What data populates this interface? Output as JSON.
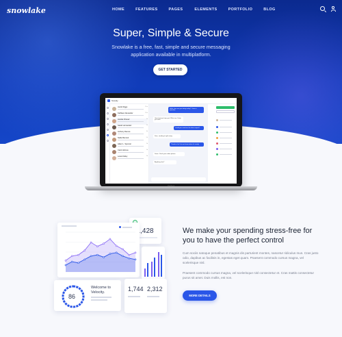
{
  "brand": {
    "logo": "snowlake"
  },
  "nav": {
    "items": [
      "HOME",
      "FEATURES",
      "PAGES",
      "ELEMENTS",
      "PORTFOLIO",
      "BLOG"
    ]
  },
  "icons": {
    "search": "search-icon",
    "user": "user-icon"
  },
  "hero": {
    "title": "Super, Simple & Secure",
    "subtitle": "Snowlake is a free, fast, simple and secure messaging application available in multiplatform.",
    "cta": "GET STARTED"
  },
  "laptop": {
    "brand": "MacBook",
    "app_name": "Snowly"
  },
  "feature": {
    "heading": "We make your spending stress-free for you to have the perfect control",
    "para1": "Cum sociis natoque penatibus et magnis dis parturient montes, nascetur ridiculus mus. Cras justo odio, dapibus ac facilisis in, egestas eget quam. Praesent commodo cursus magna, vel scelerisque nisl.",
    "para2": "Praesent commodo cursus magna, vel scelerisque nisl consectetur et. Cras mattis consectetur purus sit amet. Duis mollis, est non.",
    "button": "MORE DETAILS"
  },
  "dashboard": {
    "amount": "$1,428",
    "gauge_value": "86",
    "welcome_title": "Welcome to Velocity.",
    "stat_left": "1,744",
    "stat_right": "2,312"
  },
  "colors": {
    "primary": "#2a56e8",
    "hero_dark": "#0b2a8f",
    "accent_purple": "#7a5cf0",
    "success": "#2ebd6b"
  },
  "chart_data": {
    "type": "area",
    "x": [
      1,
      2,
      3,
      4,
      5,
      6,
      7,
      8,
      9,
      10,
      11,
      12
    ],
    "series": [
      {
        "values": [
          20,
          28,
          30,
          38,
          52,
          45,
          50,
          58,
          46,
          40,
          30,
          34
        ]
      },
      {
        "values": [
          12,
          18,
          16,
          22,
          28,
          30,
          26,
          32,
          34,
          28,
          24,
          22
        ]
      }
    ],
    "ylim": [
      0,
      70
    ]
  }
}
